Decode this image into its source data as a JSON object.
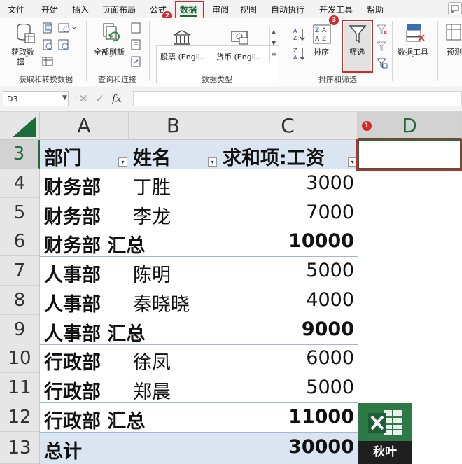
{
  "menu": {
    "tabs": [
      "文件",
      "开始",
      "插入",
      "页面布局",
      "公式",
      "数据",
      "审阅",
      "视图",
      "自动执行",
      "开发工具",
      "帮助"
    ],
    "active_tab": "数据"
  },
  "annotations": {
    "step1": "1",
    "step2": "2",
    "step3": "3"
  },
  "ribbon": {
    "get_data_label": "获取数\n据",
    "get_data_label_line1": "获取数",
    "get_data_label_line2": "据",
    "refresh_all_label": "全部刷新",
    "stocks_label": "股票 (Engli...",
    "currency_label": "货币 (Engli...",
    "sort_label": "排序",
    "filter_label": "筛选",
    "data_tools_label": "数据工具",
    "forecast_label": "预测",
    "group_get_transform": "获取和转换数据",
    "group_queries": "查询和连接",
    "group_data_types": "数据类型",
    "group_sort_filter": "排序和筛选"
  },
  "formula_bar": {
    "name_box": "D3",
    "formula": ""
  },
  "grid": {
    "columns": [
      "A",
      "B",
      "C",
      "D"
    ],
    "selected_column": "D",
    "rows": [
      {
        "num": "3",
        "a": "部门",
        "b": "姓名",
        "c": "求和项:工资",
        "header": true
      },
      {
        "num": "4",
        "a": "财务部",
        "b": "丁胜",
        "c": "3000"
      },
      {
        "num": "5",
        "a": "财务部",
        "b": "李龙",
        "c": "7000"
      },
      {
        "num": "6",
        "a": "财务部 汇总",
        "b": "",
        "c": "10000",
        "subtotal": true
      },
      {
        "num": "7",
        "a": "人事部",
        "b": "陈明",
        "c": "5000"
      },
      {
        "num": "8",
        "a": "人事部",
        "b": "秦晓晓",
        "c": "4000"
      },
      {
        "num": "9",
        "a": "人事部 汇总",
        "b": "",
        "c": "9000",
        "subtotal": true
      },
      {
        "num": "10",
        "a": "行政部",
        "b": "徐凤",
        "c": "6000"
      },
      {
        "num": "11",
        "a": "行政部",
        "b": "郑晨",
        "c": "5000"
      },
      {
        "num": "12",
        "a": "行政部 汇总",
        "b": "",
        "c": "11000",
        "subtotal": true
      },
      {
        "num": "13",
        "a": "总计",
        "b": "",
        "c": "30000",
        "total": true
      }
    ]
  },
  "logo_text": "秋叶",
  "colors": {
    "accent": "#1e6c3a",
    "annotation": "#d12a2a",
    "pivot_header": "#dbe4f1"
  }
}
